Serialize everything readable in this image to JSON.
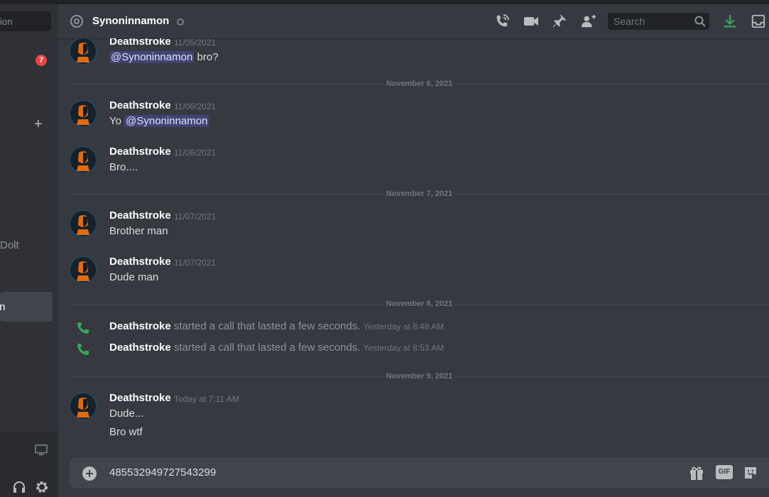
{
  "sidebar": {
    "search_placeholder": "ion",
    "badge_count": "7",
    "plus_label": "+",
    "partial_item_dolt": "Dolt",
    "selected_item_label": "n"
  },
  "header": {
    "channel_name": "Synoninnamon",
    "search_placeholder": "Search"
  },
  "messages": [
    {
      "author": "Deathstroke",
      "timestamp": "11/05/2021",
      "lines": [
        {
          "mention": "@Synoninnamon",
          "text": " bro?"
        }
      ]
    },
    {
      "divider": "November 6, 2021"
    },
    {
      "author": "Deathstroke",
      "timestamp": "11/06/2021",
      "lines": [
        {
          "prefix": "Yo ",
          "mention": "@Synoninnamon"
        }
      ]
    },
    {
      "author": "Deathstroke",
      "timestamp": "11/06/2021",
      "lines": [
        {
          "text": "Bro...."
        }
      ]
    },
    {
      "divider": "November 7, 2021"
    },
    {
      "author": "Deathstroke",
      "timestamp": "11/07/2021",
      "lines": [
        {
          "text": "Brother man"
        }
      ]
    },
    {
      "author": "Deathstroke",
      "timestamp": "11/07/2021",
      "lines": [
        {
          "text": "Dude man"
        }
      ]
    },
    {
      "divider": "November 8, 2021"
    },
    {
      "call": true,
      "author": "Deathstroke",
      "text": "started a call that lasted a few seconds.",
      "timestamp": "Yesterday at 8:48 AM"
    },
    {
      "call": true,
      "author": "Deathstroke",
      "text": "started a call that lasted a few seconds.",
      "timestamp": "Yesterday at 8:53 AM"
    },
    {
      "divider": "November 9, 2021"
    },
    {
      "author": "Deathstroke",
      "timestamp": "Today at 7:11 AM",
      "lines": [
        {
          "text": "Dude..."
        },
        {
          "text": "Bro wtf"
        }
      ]
    }
  ],
  "composer": {
    "value": "485532949727543299",
    "gif_label": "GIF"
  },
  "colors": {
    "background": "#36393f",
    "sidebar": "#2f3136",
    "mention_bg": "#414675",
    "call_green": "#3ba55d",
    "badge_red": "#ed4245",
    "download_green": "#3ba55d"
  },
  "icons": [
    "at-icon",
    "phone-call-icon",
    "video-icon",
    "pin-icon",
    "add-friend-icon",
    "search-icon",
    "download-icon",
    "inbox-icon",
    "plus-circle-icon",
    "gift-icon",
    "sticker-icon",
    "screen-share-icon",
    "headset-icon",
    "gear-icon",
    "call-phone-icon"
  ]
}
